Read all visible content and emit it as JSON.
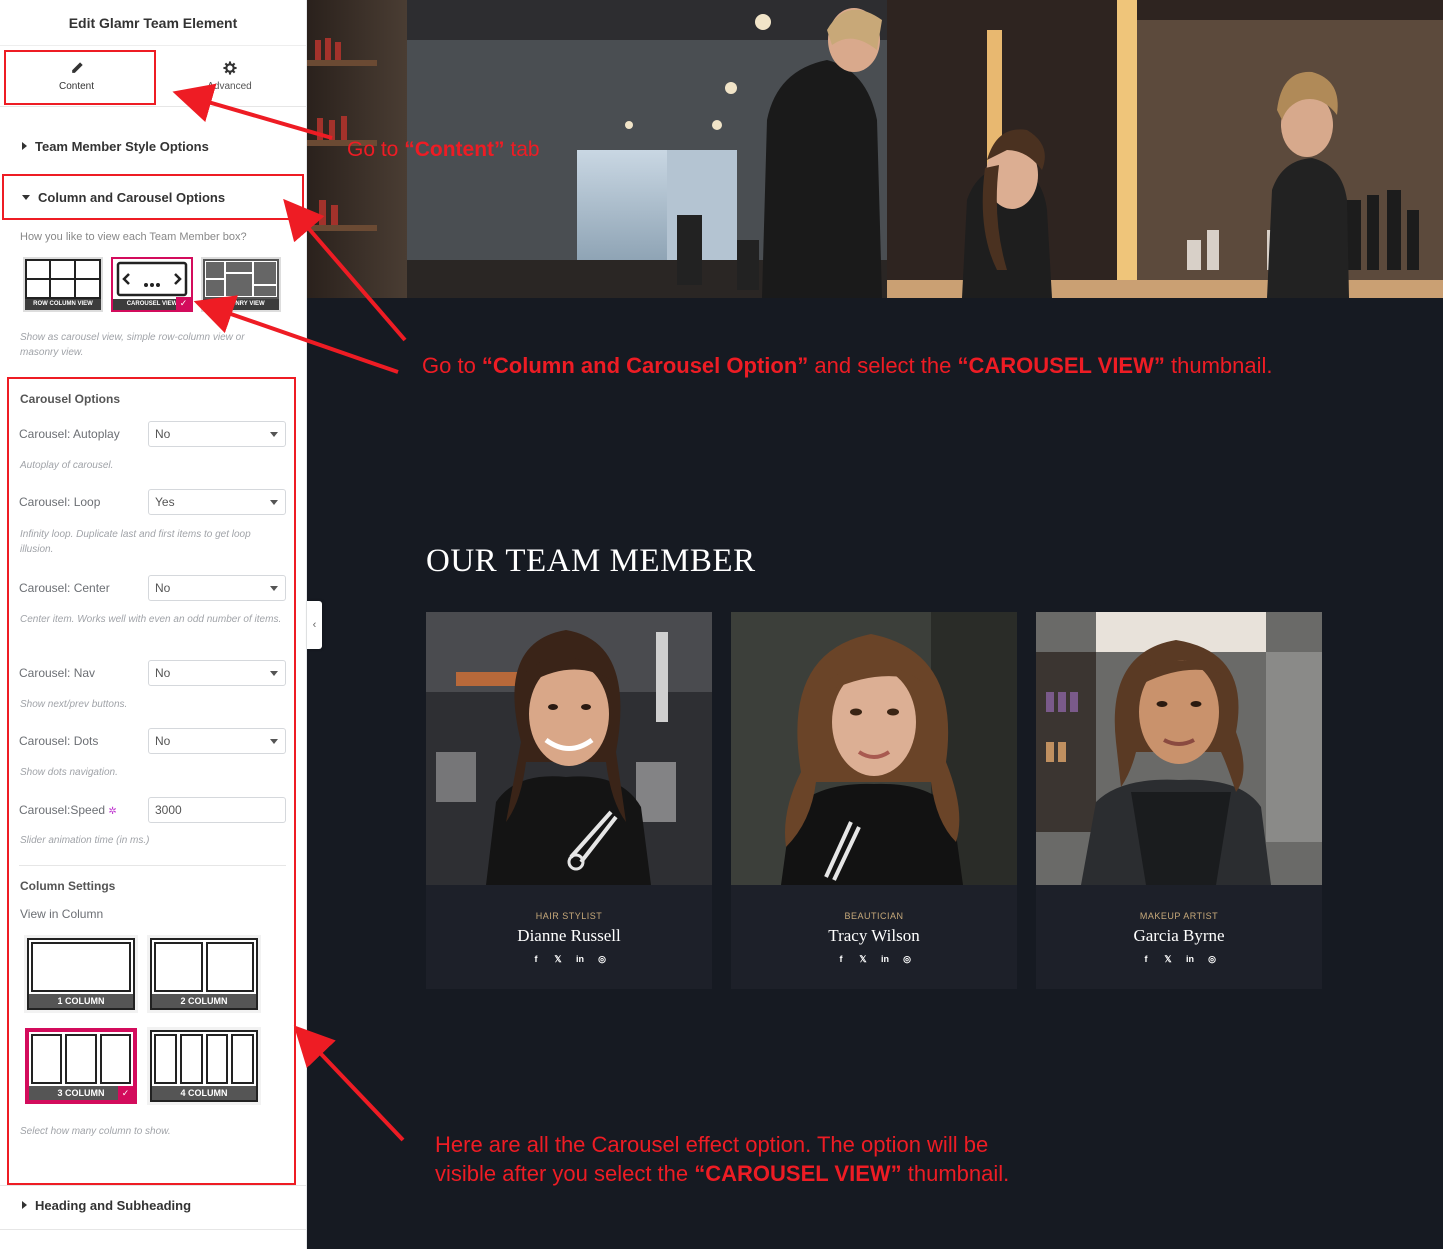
{
  "editor": {
    "title": "Edit Glamr Team Element",
    "tabs": [
      {
        "label": "Content",
        "icon": "pencil-icon"
      },
      {
        "label": "Advanced",
        "icon": "gear-icon"
      }
    ],
    "sections": {
      "style": "Team Member Style Options",
      "column_carousel": "Column and Carousel Options",
      "heading": "Heading and Subheading"
    },
    "view_question": "How you like to view each Team Member box?",
    "view_thumbs": [
      "ROW COLUMN VIEW",
      "CAROUSEL VIEW",
      "MASONRY VIEW"
    ],
    "view_hint": "Show as carousel view, simple row-column view or masonry view.",
    "carousel": {
      "title": "Carousel Options",
      "autoplay": {
        "label": "Carousel: Autoplay",
        "value": "No",
        "hint": "Autoplay of carousel."
      },
      "loop": {
        "label": "Carousel: Loop",
        "value": "Yes",
        "hint": "Infinity loop. Duplicate last and first items to get loop illusion."
      },
      "center": {
        "label": "Carousel: Center",
        "value": "No",
        "hint": "Center item. Works well with even an odd number of items."
      },
      "nav": {
        "label": "Carousel: Nav",
        "value": "No",
        "hint": "Show next/prev buttons."
      },
      "dots": {
        "label": "Carousel: Dots",
        "value": "No",
        "hint": "Show dots navigation."
      },
      "speed": {
        "label": "Carousel:Speed",
        "value": "3000",
        "hint": "Slider animation time (in ms.)"
      }
    },
    "column_settings": {
      "title": "Column Settings",
      "view_label": "View in Column",
      "options": [
        "1 COLUMN",
        "2 COLUMN",
        "3 COLUMN",
        "4 COLUMN"
      ],
      "selected": "3 COLUMN",
      "hint": "Select how many column to show."
    }
  },
  "preview": {
    "section_title": "OUR TEAM MEMBER",
    "members": [
      {
        "role": "HAIR STYLIST",
        "name": "Dianne Russell"
      },
      {
        "role": "BEAUTICIAN",
        "name": "Tracy Wilson"
      },
      {
        "role": "MAKEUP ARTIST",
        "name": "Garcia Byrne"
      }
    ],
    "social_icons": [
      "f",
      "𝕏",
      "in",
      "◎"
    ]
  },
  "annotations": {
    "content_tab": {
      "pre": "Go  to ",
      "bold": "“Content”",
      "post": " tab"
    },
    "carousel_option": {
      "pre": "Go to ",
      "bold1": "“Column and Carousel Option”",
      "mid": " and select the ",
      "bold2": "“CAROUSEL VIEW”",
      "post": " thumbnail."
    },
    "all_options": {
      "line1": "Here are all the Carousel effect option. The option will be",
      "line2_pre": "visible after you select the ",
      "line2_bold": "“CAROUSEL VIEW”",
      "line2_post": " thumbnail."
    }
  },
  "colors": {
    "accent": "#d30c5c",
    "annotation": "#ee1c24",
    "dark_bg": "#161a22",
    "card_bg": "#1d2029",
    "role_gold": "#c7a97a"
  }
}
